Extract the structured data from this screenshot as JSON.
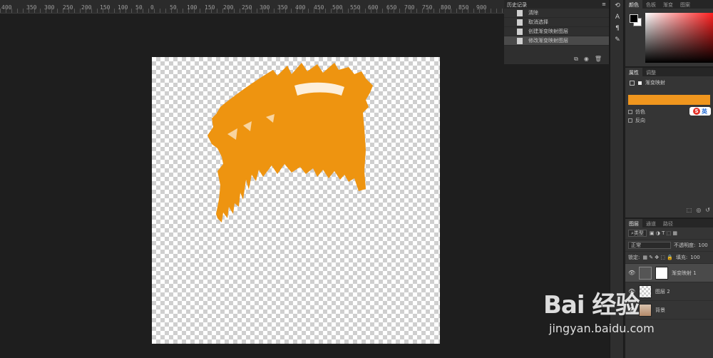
{
  "ruler": {
    "labels": [
      "400",
      "350",
      "300",
      "250",
      "200",
      "150",
      "100",
      "50",
      "0",
      "50",
      "100",
      "150",
      "200",
      "250",
      "300",
      "350",
      "400",
      "450",
      "500",
      "550",
      "600",
      "650",
      "700",
      "750",
      "800",
      "850",
      "900"
    ]
  },
  "history": {
    "title": "历史记录",
    "items": [
      {
        "label": "清除"
      },
      {
        "label": "取消选择"
      },
      {
        "label": "创建渐变映射图层"
      },
      {
        "label": "修改渐变映射图层"
      }
    ]
  },
  "color_panel": {
    "tabs": [
      "颜色",
      "色板",
      "渐变",
      "图案"
    ],
    "foreground": "#000000",
    "background": "#ffffff"
  },
  "properties": {
    "tabs": [
      "属性",
      "调整"
    ],
    "adjustment_name": "渐变映射",
    "gradient_color": "#f0961e",
    "options": [
      "仿色",
      "反向"
    ],
    "ime_label": "英"
  },
  "layers_panel": {
    "tabs": [
      "图层",
      "通道",
      "路径"
    ],
    "filter_type": "类型",
    "blend_mode": "正常",
    "opacity_label": "不透明度:",
    "opacity_value": "100",
    "lock_label": "锁定:",
    "fill_label": "填充:",
    "fill_value": "100",
    "layers": [
      {
        "name": "渐变映射 1",
        "selected": true
      },
      {
        "name": "图层 2",
        "selected": false
      },
      {
        "name": "背景",
        "selected": false
      }
    ]
  },
  "canvas": {
    "shape_color": "#ee9410"
  },
  "watermark": {
    "main": "Bai 经验",
    "sub": "jingyan.baidu.com"
  }
}
